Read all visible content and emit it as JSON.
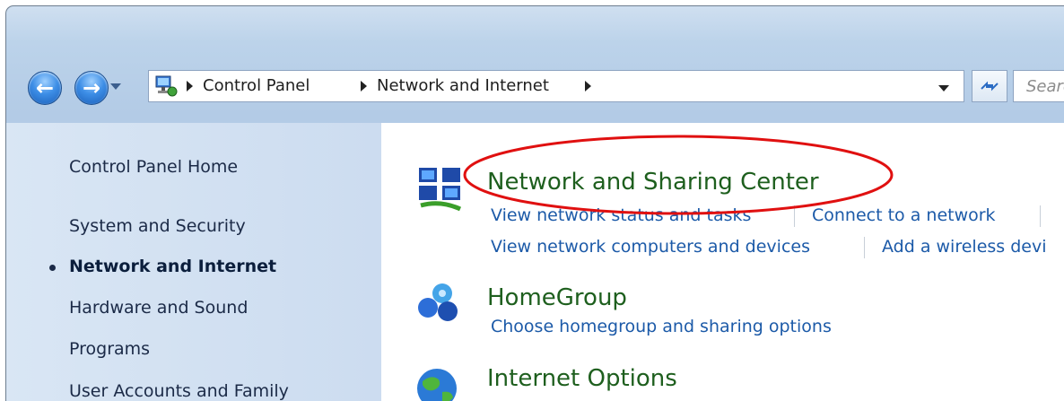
{
  "address_bar": {
    "breadcrumbs": [
      "Control Panel",
      "Network and Internet"
    ],
    "search_placeholder": "Search"
  },
  "sidebar": {
    "items": [
      {
        "label": "Control Panel Home"
      },
      {
        "label": "System and Security"
      },
      {
        "label": "Network and Internet",
        "current": true
      },
      {
        "label": "Hardware and Sound"
      },
      {
        "label": "Programs"
      },
      {
        "label": "User Accounts and Family"
      }
    ]
  },
  "categories": [
    {
      "title": "Network and Sharing Center",
      "icon": "network-icon",
      "tasks": [
        "View network status and tasks",
        "Connect to a network",
        "View network computers and devices",
        "Add a wireless devi"
      ]
    },
    {
      "title": "HomeGroup",
      "icon": "homegroup-icon",
      "tasks": [
        "Choose homegroup and sharing options"
      ]
    },
    {
      "title": "Internet Options",
      "icon": "globe-icon",
      "tasks": []
    }
  ],
  "annotation": {
    "shape": "ellipse",
    "color": "#e01010",
    "target": "Network and Sharing Center"
  }
}
